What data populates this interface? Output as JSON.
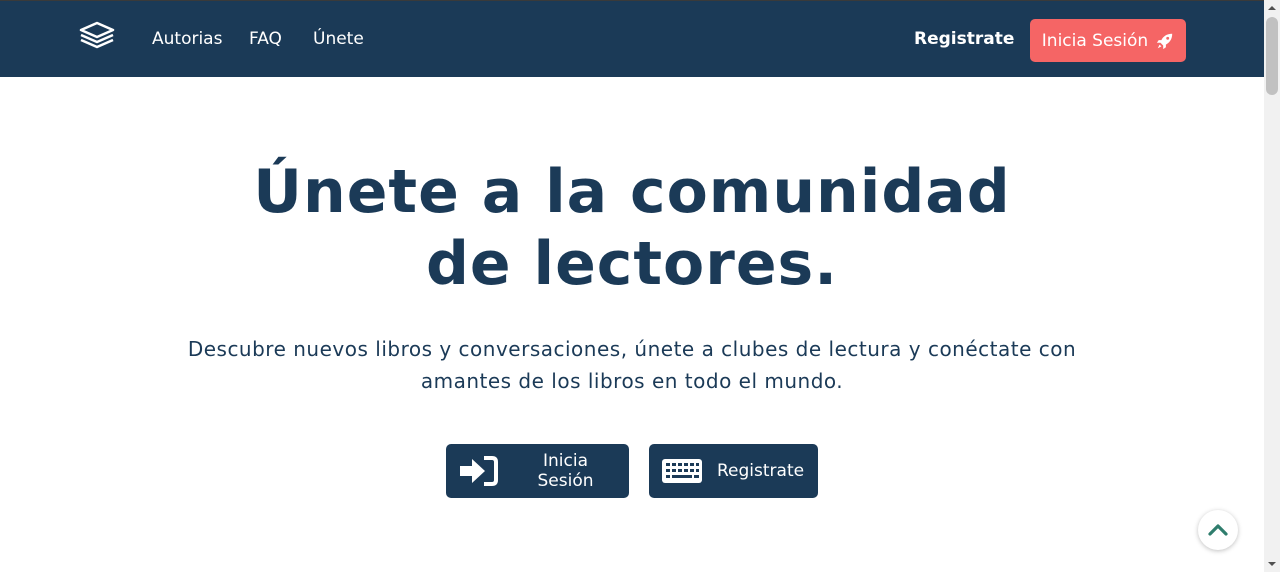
{
  "nav": {
    "logo_icon": "book-stack-icon",
    "links": [
      "Autorias",
      "FAQ",
      "Únete"
    ],
    "register_label": "Registrate",
    "login_label": "Inicia Sesión",
    "login_icon": "rocket-icon"
  },
  "hero": {
    "title": "Únete a la comunidad de lectores.",
    "subtitle": "Descubre nuevos libros y conversaciones, únete a clubes de lectura y conéctate con amantes de los libros en todo el mundo.",
    "login_button": {
      "label": "Inicia Sesión",
      "icon": "sign-in-icon"
    },
    "register_button": {
      "label": "Registrate",
      "icon": "keyboard-icon"
    }
  },
  "scroll_top": {
    "icon": "chevron-up-icon"
  },
  "colors": {
    "primary": "#1b3a57",
    "accent": "#f56565",
    "background": "#ffffff"
  }
}
